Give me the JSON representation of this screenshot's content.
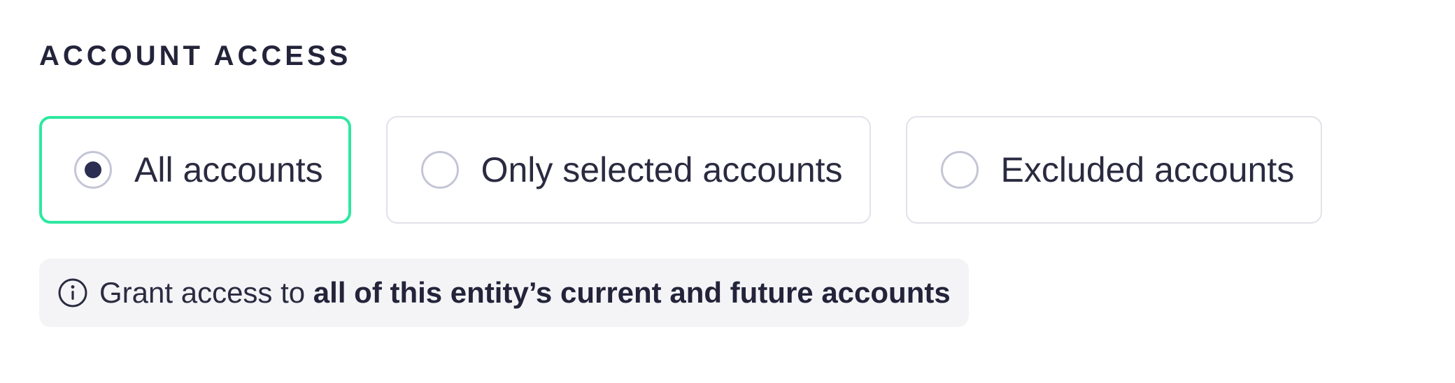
{
  "section": {
    "title": "ACCOUNT ACCESS"
  },
  "options": [
    {
      "label": "All accounts",
      "selected": true
    },
    {
      "label": "Only selected accounts",
      "selected": false
    },
    {
      "label": "Excluded accounts",
      "selected": false
    }
  ],
  "info": {
    "icon": "info-icon",
    "prefix": "Grant access to ",
    "emphasis": "all of this entity’s current and future accounts"
  },
  "colors": {
    "selected_border": "#2ee8a0",
    "radio_dot": "#2c2d52",
    "info_background": "#f4f4f7",
    "text": "#2a2b40"
  }
}
